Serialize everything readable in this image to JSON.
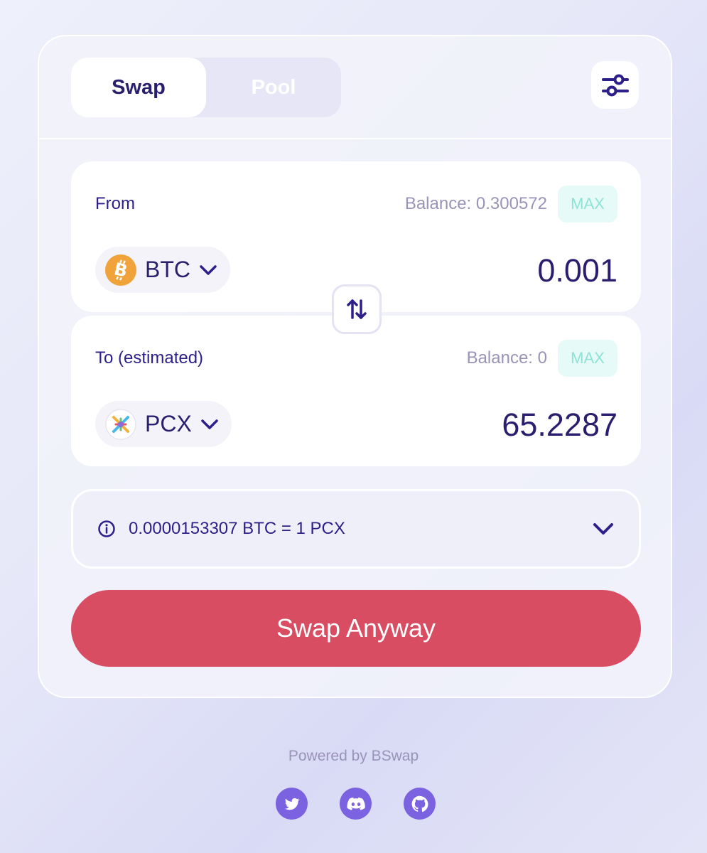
{
  "tabs": [
    {
      "label": "Swap",
      "active": true
    },
    {
      "label": "Pool",
      "active": false
    }
  ],
  "from": {
    "label": "From",
    "balance": "Balance: 0.300572",
    "max_label": "MAX",
    "token": "BTC",
    "token_icon": "bitcoin-icon",
    "amount": "0.001"
  },
  "to": {
    "label": "To (estimated)",
    "balance": "Balance: 0",
    "max_label": "MAX",
    "token": "PCX",
    "token_icon": "pcx-icon",
    "amount": "65.2287"
  },
  "rate": {
    "text": "0.0000153307 BTC = 1 PCX"
  },
  "swap_button": "Swap Anyway",
  "footer": {
    "powered_by": "Powered by BSwap",
    "socials": [
      "twitter-icon",
      "discord-icon",
      "github-icon"
    ]
  },
  "colors": {
    "accent": "#d94d63",
    "primary_text": "#2a1f6e",
    "social": "#7a62e0",
    "max_bg": "#e6fbf8",
    "max_text": "#8fe3d5"
  }
}
